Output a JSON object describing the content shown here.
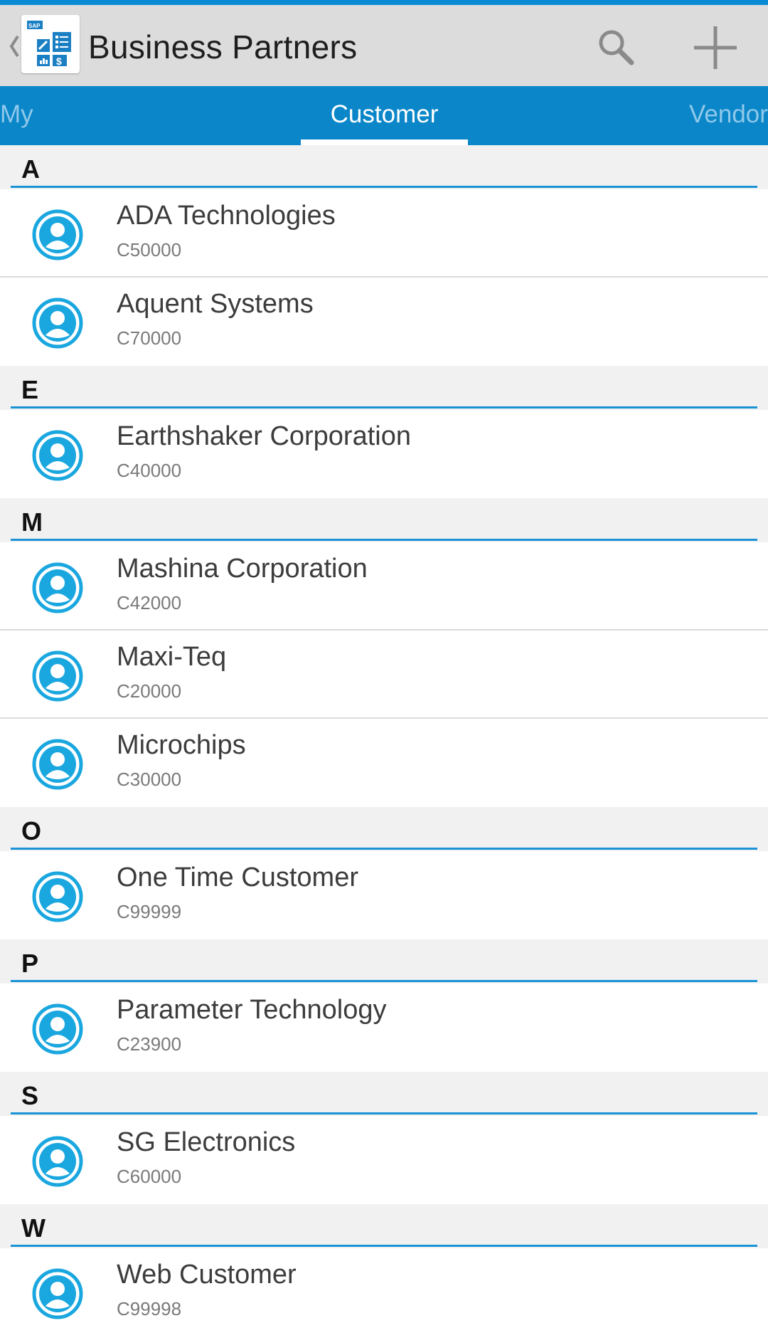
{
  "header": {
    "title": "Business Partners",
    "back_icon": "chevron-left-icon",
    "app_icon": "sap-business-app-icon",
    "search_icon": "search-icon",
    "add_icon": "plus-icon"
  },
  "tabs": [
    {
      "label": "My",
      "selected": false
    },
    {
      "label": "Customer",
      "selected": true
    },
    {
      "label": "Vendor",
      "selected": false
    }
  ],
  "colors": {
    "accent": "#0a86c9",
    "actionbar": "#dcdcdc",
    "section_rule": "#1a93d6",
    "avatar": "#1aa7df"
  },
  "sections": [
    {
      "letter": "A",
      "items": [
        {
          "name": "ADA Technologies",
          "code": "C50000"
        },
        {
          "name": "Aquent Systems",
          "code": "C70000"
        }
      ]
    },
    {
      "letter": "E",
      "items": [
        {
          "name": "Earthshaker Corporation",
          "code": "C40000"
        }
      ]
    },
    {
      "letter": "M",
      "items": [
        {
          "name": "Mashina Corporation",
          "code": "C42000"
        },
        {
          "name": "Maxi-Teq",
          "code": "C20000"
        },
        {
          "name": "Microchips",
          "code": "C30000"
        }
      ]
    },
    {
      "letter": "O",
      "items": [
        {
          "name": "One Time Customer",
          "code": "C99999"
        }
      ]
    },
    {
      "letter": "P",
      "items": [
        {
          "name": "Parameter Technology",
          "code": "C23900"
        }
      ]
    },
    {
      "letter": "S",
      "items": [
        {
          "name": "SG Electronics",
          "code": "C60000"
        }
      ]
    },
    {
      "letter": "W",
      "items": [
        {
          "name": "Web Customer",
          "code": "C99998"
        }
      ]
    }
  ]
}
